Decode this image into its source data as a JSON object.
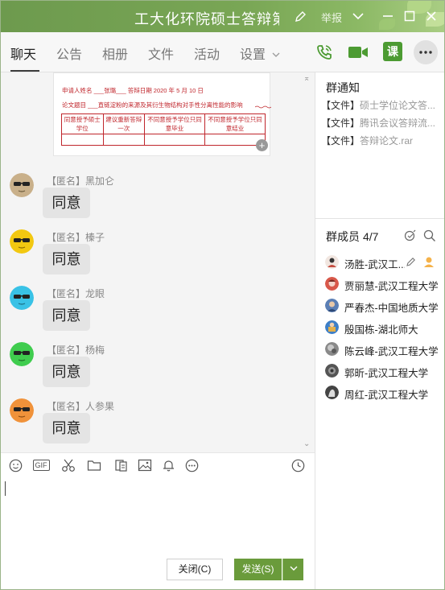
{
  "window": {
    "title": "工大化环院硕士答辩第...",
    "report_label": "举报"
  },
  "tabs": [
    {
      "label": "聊天"
    },
    {
      "label": "公告"
    },
    {
      "label": "相册"
    },
    {
      "label": "文件"
    },
    {
      "label": "活动"
    },
    {
      "label": "设置"
    }
  ],
  "header_actions": {
    "lesson_label": "课"
  },
  "document_preview": {
    "applicant_line": "申请人姓名 ___张璐___ 答辩日期  2020  年   5  月   10  日",
    "topic_line": "论文题目 ___直链淀粉的来源及其衍生物结构对手性分离性能的影响",
    "options": [
      "同意授予硕士学位",
      "建议重新答辩一次",
      "不同意授予学位只同意毕业",
      "不同意授予学位只同意结业"
    ]
  },
  "messages": [
    {
      "sender": "【匿名】黑加仑",
      "text": "同意",
      "avatar_color": "#c9b08a"
    },
    {
      "sender": "【匿名】榛子",
      "text": "同意",
      "avatar_color": "#f2c811"
    },
    {
      "sender": "【匿名】龙眼",
      "text": "同意",
      "avatar_color": "#39c2e6"
    },
    {
      "sender": "【匿名】杨梅",
      "text": "同意",
      "avatar_color": "#3fcc4e"
    },
    {
      "sender": "【匿名】人参果",
      "text": "同意",
      "avatar_color": "#f0923a"
    }
  ],
  "toolbar_icons": [
    "emoji-icon",
    "gif-icon",
    "scissors-icon",
    "folder-icon",
    "doc-icon",
    "image-icon",
    "bell-icon",
    "more-icon",
    "history-icon"
  ],
  "toolbar": {
    "gif_label": "GIF"
  },
  "composer": {
    "close_label": "关闭(C)",
    "send_label": "发送(S)"
  },
  "notice": {
    "title": "群通知",
    "files": [
      {
        "tag": "【文件】",
        "name": "硕士学位论文答..."
      },
      {
        "tag": "【文件】",
        "name": "腾讯会议答辩流..."
      },
      {
        "tag": "【文件】",
        "name": "答辩论文.rar"
      }
    ]
  },
  "members": {
    "title": "群成员",
    "count": "4/7",
    "list": [
      {
        "name": "汤胜-武汉工...",
        "avatar_color": "#c44b3e"
      },
      {
        "name": "贾丽慧-武汉工程大学",
        "avatar_color": "#d8584a"
      },
      {
        "name": "严春杰-中国地质大学",
        "avatar_color": "#5b7fb5"
      },
      {
        "name": "殷国栋-湖北师大",
        "avatar_color": "#3e7fc7"
      },
      {
        "name": "陈云峰-武汉工程大学",
        "avatar_color": "#8a8a8a"
      },
      {
        "name": "郭昕-武汉工程大学",
        "avatar_color": "#555555"
      },
      {
        "name": "周红-武汉工程大学",
        "avatar_color": "#444444"
      }
    ]
  },
  "colors": {
    "accent_green": "#6a9b3b",
    "title_bar": "#79a655",
    "doc_red": "#c0262c"
  }
}
